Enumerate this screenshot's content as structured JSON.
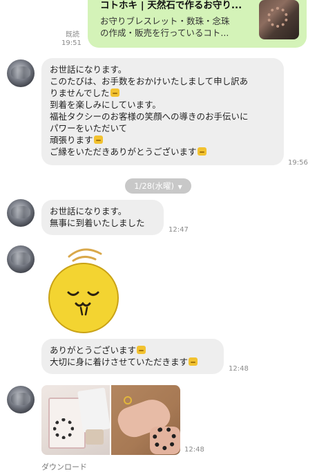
{
  "top_link_card": {
    "title": "コトホキ | 天然石で作るお守り...",
    "desc_line1": "お守りブレスレット・数珠・念珠",
    "desc_line2": "の作成・販売を行っているコト...",
    "read_label": "既読",
    "time": "19:51"
  },
  "messages": [
    {
      "lines": [
        "お世話になります。",
        "このたびは、お手数をおかけいたしまして申し訳あ",
        "りませんでした",
        "到着を楽しみにしています。",
        "福祉タクシーのお客様の笑顔への導きのお手伝いに",
        "パワーをいただいて",
        "頑張ります",
        "ご縁をいただきありがとうございます"
      ],
      "time": "19:56"
    }
  ],
  "date_chip": "1/28(水曜)",
  "msg2": {
    "line1": "お世話になります。",
    "line2": "無事に到着いたしました",
    "time": "12:47"
  },
  "sticker": {
    "name": "sleepy-face-sticker"
  },
  "msg3": {
    "line1": "ありがとうございます",
    "line2": "大切に身に着けさせていただきます",
    "time": "12:48"
  },
  "photos": {
    "time": "12:48",
    "download_label": "ダウンロード"
  }
}
